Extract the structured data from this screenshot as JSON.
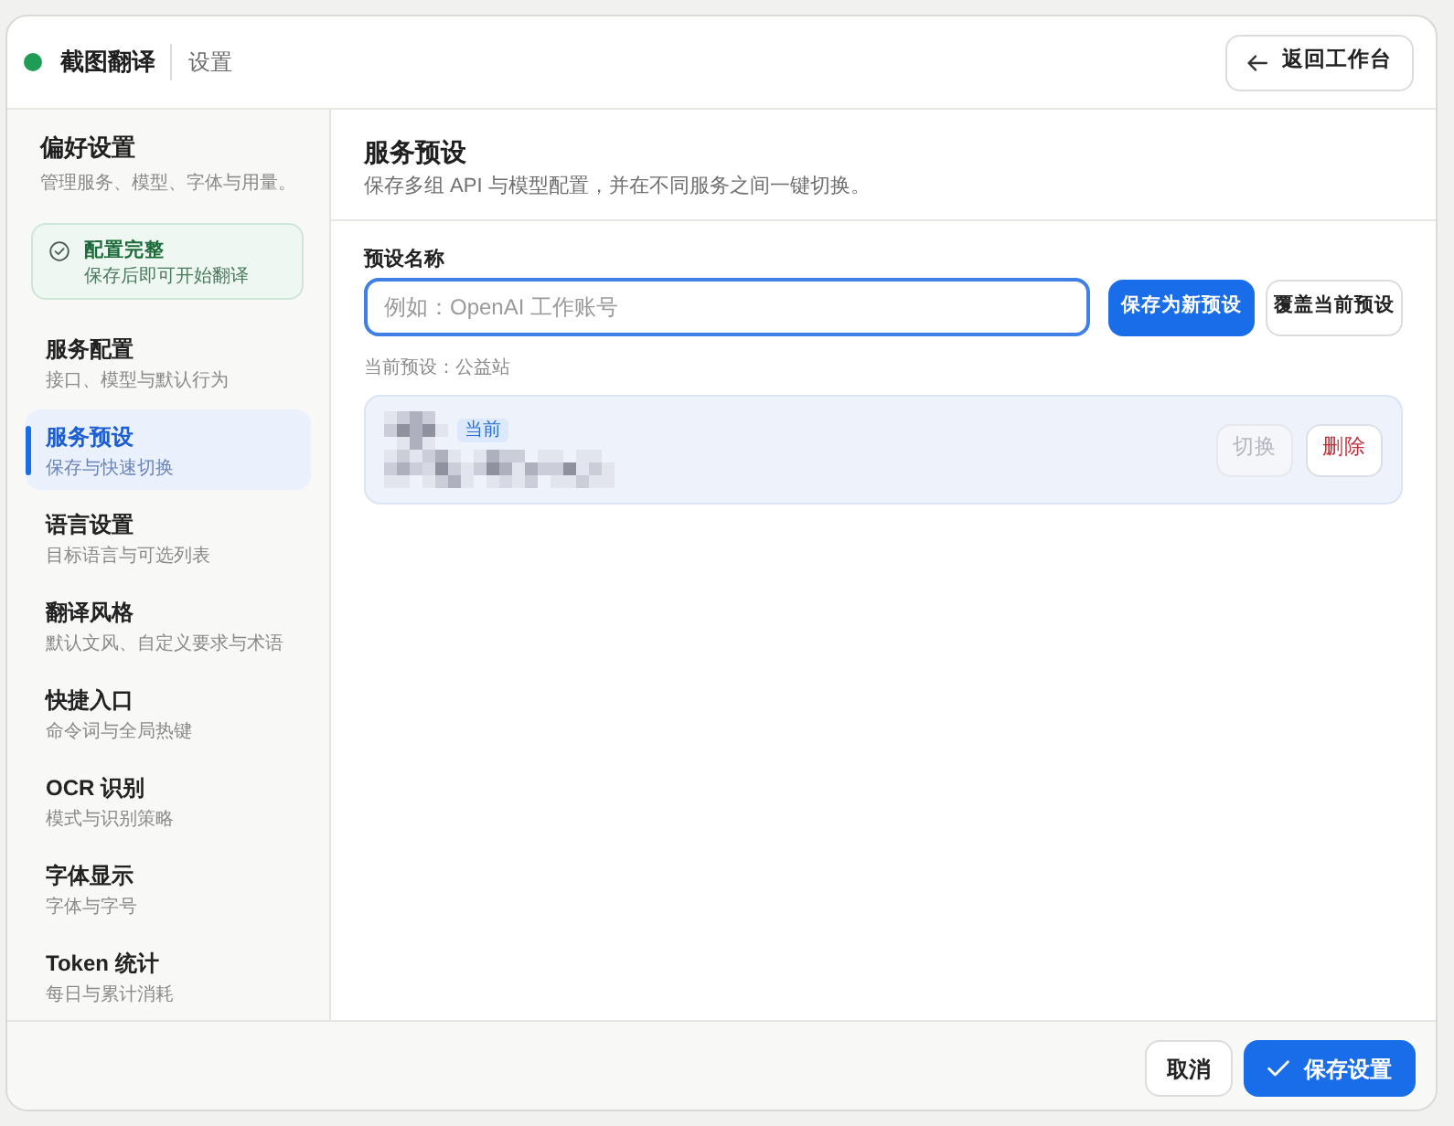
{
  "header": {
    "app_name": "截图翻译",
    "page": "设置",
    "back_button": "返回工作台"
  },
  "sidebar": {
    "title": "偏好设置",
    "subtitle": "管理服务、模型、字体与用量。",
    "status_card": {
      "title": "配置完整",
      "subtitle": "保存后即可开始翻译"
    },
    "items": [
      {
        "title": "服务配置",
        "subtitle": "接口、模型与默认行为",
        "selected": false
      },
      {
        "title": "服务预设",
        "subtitle": "保存与快速切换",
        "selected": true
      },
      {
        "title": "语言设置",
        "subtitle": "目标语言与可选列表",
        "selected": false
      },
      {
        "title": "翻译风格",
        "subtitle": "默认文风、自定义要求与术语",
        "selected": false
      },
      {
        "title": "快捷入口",
        "subtitle": "命令词与全局热键",
        "selected": false
      },
      {
        "title": "OCR 识别",
        "subtitle": "模式与识别策略",
        "selected": false
      },
      {
        "title": "字体显示",
        "subtitle": "字体与字号",
        "selected": false
      },
      {
        "title": "Token 统计",
        "subtitle": "每日与累计消耗",
        "selected": false
      }
    ]
  },
  "main": {
    "title": "服务预设",
    "description": "保存多组 API 与模型配置，并在不同服务之间一键切换。",
    "name_field": {
      "label": "预设名称",
      "placeholder": "例如：OpenAI 工作账号"
    },
    "form_buttons": [
      {
        "label": "保存为新预设",
        "kind": "primary"
      },
      {
        "label": "覆盖当前预设",
        "kind": "secondary"
      }
    ],
    "current_preset": "当前预设：公益站",
    "presets": [
      {
        "selected": true,
        "badge": "当前",
        "actions": [
          {
            "label": "切换",
            "kind": "switch",
            "disabled": true
          },
          {
            "label": "删除",
            "kind": "delete",
            "disabled": false
          }
        ]
      }
    ]
  },
  "footer": {
    "buttons": [
      {
        "label": "取消",
        "kind": "secondary"
      },
      {
        "label": "保存设置",
        "kind": "primary"
      }
    ]
  }
}
